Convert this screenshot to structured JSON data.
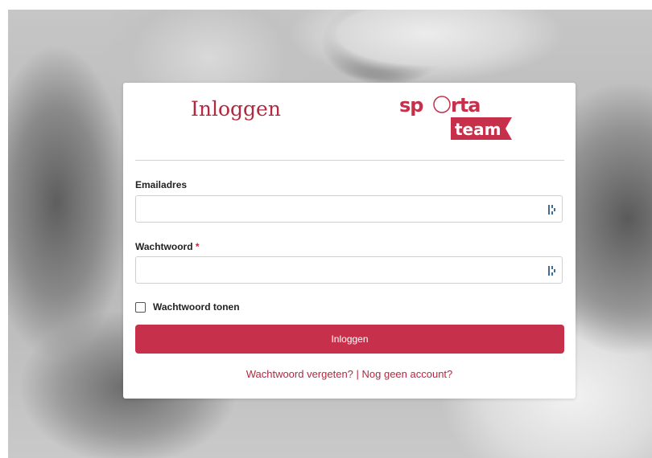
{
  "login": {
    "title": "Inloggen",
    "logo": {
      "line1": "sporta",
      "line2": "team"
    },
    "email_label": "Emailadres",
    "email_value": "",
    "password_label": "Wachtwoord",
    "password_required_mark": "*",
    "password_value": "",
    "show_password_label": "Wachtwoord tonen",
    "submit_label": "Inloggen",
    "forgot_link": "Wachtwoord vergeten?",
    "separator": " | ",
    "register_link": "Nog geen account?"
  },
  "colors": {
    "brand": "#c7304a",
    "brand_text": "#b3283f"
  },
  "icons": {
    "email_field": "password-manager-icon",
    "password_field": "password-manager-icon"
  }
}
